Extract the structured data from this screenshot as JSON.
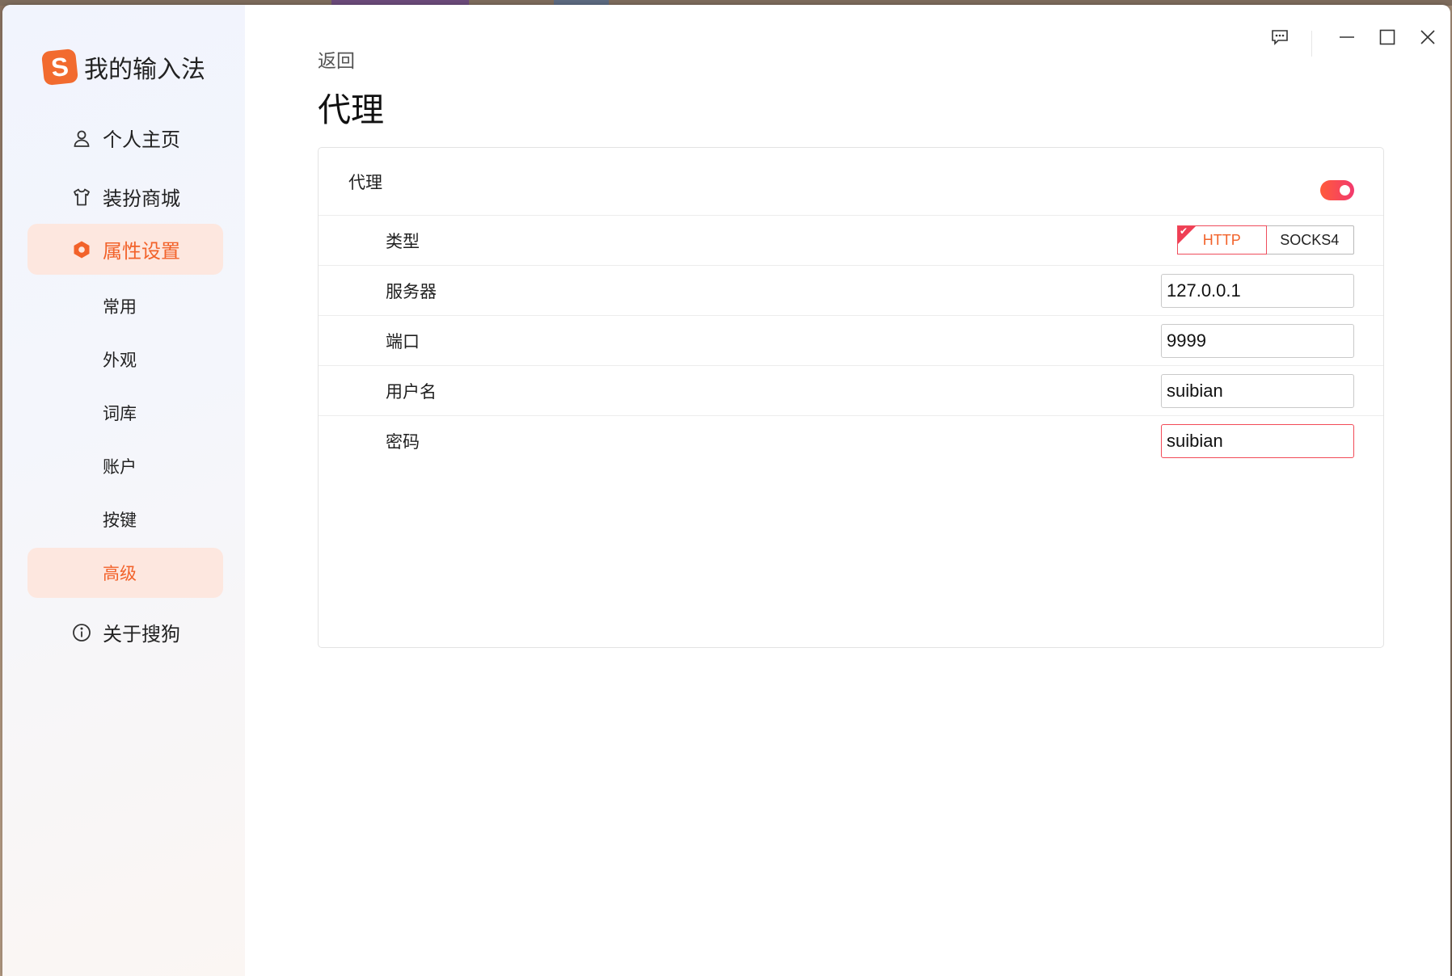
{
  "app": {
    "name": "我的输入法",
    "logo_letter": "S",
    "accent_color": "#f2622a"
  },
  "sidebar": {
    "items": [
      {
        "label": "个人主页",
        "icon": "user-icon"
      },
      {
        "label": "装扮商城",
        "icon": "shirt-icon"
      },
      {
        "label": "属性设置",
        "icon": "settings-hex-icon",
        "active": true
      },
      {
        "label": "关于搜狗",
        "icon": "info-icon"
      }
    ],
    "sub_items": [
      {
        "label": "常用"
      },
      {
        "label": "外观"
      },
      {
        "label": "词库"
      },
      {
        "label": "账户"
      },
      {
        "label": "按键"
      },
      {
        "label": "高级",
        "active": true
      }
    ]
  },
  "main": {
    "back_label": "返回",
    "title": "代理"
  },
  "proxy": {
    "label": "代理",
    "enabled": true,
    "type_label": "类型",
    "type_options": [
      "HTTP",
      "SOCKS4"
    ],
    "type_selected": "HTTP",
    "server_label": "服务器",
    "server_value": "127.0.0.1",
    "port_label": "端口",
    "port_value": "9999",
    "username_label": "用户名",
    "username_value": "suibian",
    "password_label": "密码",
    "password_value": "suibian"
  },
  "titlebar": {
    "icons": [
      "feedback-icon",
      "minimize-icon",
      "maximize-icon",
      "close-icon"
    ]
  }
}
